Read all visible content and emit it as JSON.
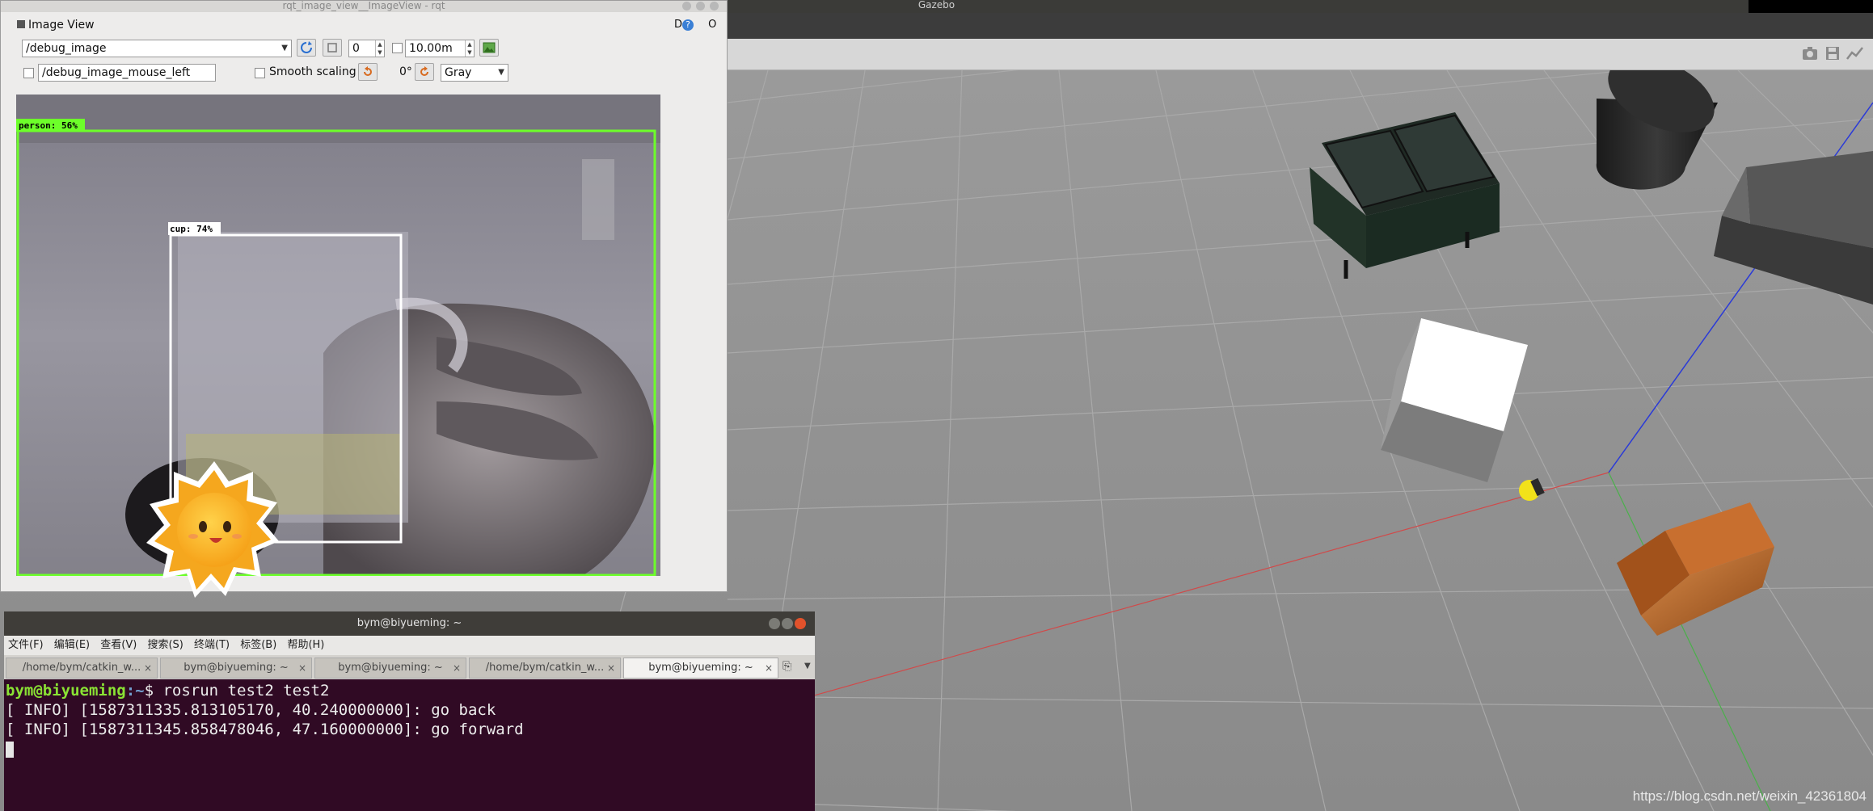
{
  "gazebo": {
    "window_title": "Gazebo",
    "watermark": "https://blog.csdn.net/weixin_42361804"
  },
  "rqt": {
    "window_title": "rqt_image_view__ImageView - rqt",
    "panel_title": "Image View",
    "panel_controls": "D",
    "help_icon": "?",
    "close_label": "O",
    "topic": "/debug_image",
    "spin_value": "0",
    "max_range": "10.00m",
    "mouse_topic": "/debug_image_mouse_left",
    "smooth_scaling_label": "Smooth scaling",
    "rotation": "0°",
    "color_scheme": "Gray",
    "detections": [
      {
        "label": "person: 56%"
      },
      {
        "label": "cup: 74%"
      }
    ]
  },
  "terminal": {
    "window_title": "bym@biyueming: ~",
    "menu": [
      "文件(F)",
      "编辑(E)",
      "查看(V)",
      "搜索(S)",
      "终端(T)",
      "标签(B)",
      "帮助(H)"
    ],
    "tabs": [
      {
        "label": "/home/bym/catkin_w..."
      },
      {
        "label": "bym@biyueming: ~"
      },
      {
        "label": "bym@biyueming: ~"
      },
      {
        "label": "/home/bym/catkin_w..."
      },
      {
        "label": "bym@biyueming: ~"
      }
    ],
    "prompt_user": "bym@biyueming",
    "prompt_path": ":~",
    "command": "$ rosrun test2 test2",
    "lines": [
      "[ INFO] [1587311335.813105170, 40.240000000]: go back",
      "[ INFO] [1587311345.858478046, 47.160000000]: go forward"
    ]
  }
}
